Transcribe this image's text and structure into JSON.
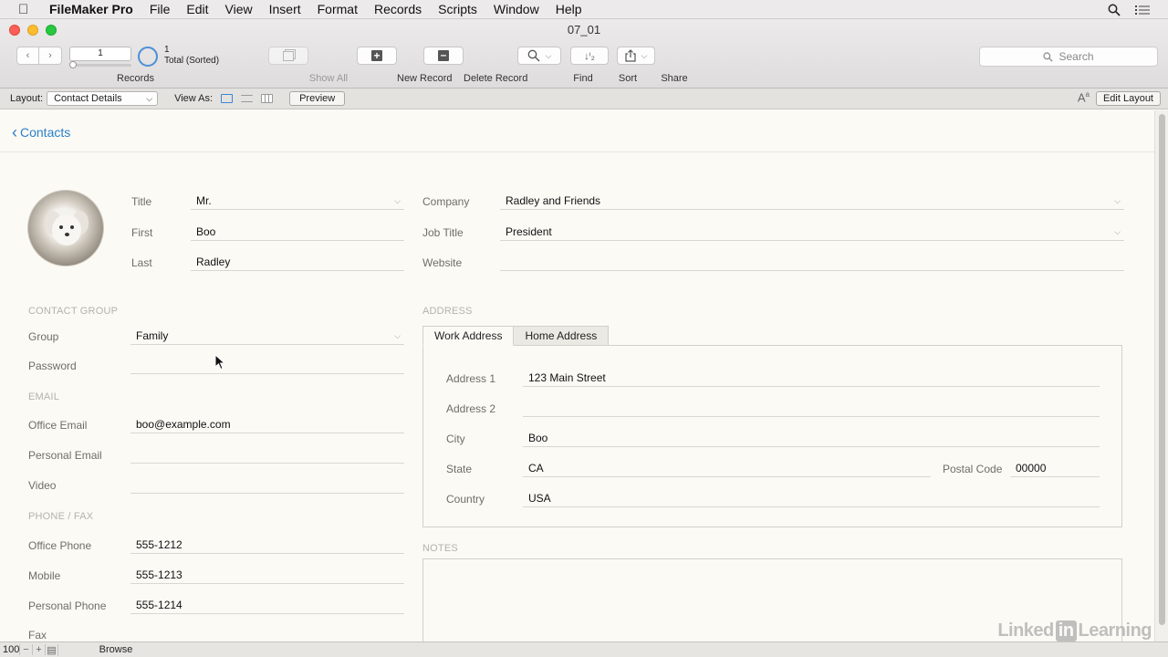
{
  "menubar": {
    "app": "FileMaker Pro",
    "items": [
      "File",
      "Edit",
      "View",
      "Insert",
      "Format",
      "Records",
      "Scripts",
      "Window",
      "Help"
    ]
  },
  "window": {
    "title": "07_01"
  },
  "toolbar": {
    "record_number": "1",
    "record_total": "1",
    "record_status": "Total (Sorted)",
    "records_label": "Records",
    "show_all": "Show All",
    "new_record": "New Record",
    "delete_record": "Delete Record",
    "find": "Find",
    "sort": "Sort",
    "share": "Share",
    "search_placeholder": "Search"
  },
  "layoutbar": {
    "layout_label": "Layout:",
    "layout_value": "Contact Details",
    "view_as_label": "View As:",
    "preview": "Preview",
    "edit_layout": "Edit Layout"
  },
  "content": {
    "back_link": "Contacts",
    "name": {
      "title_label": "Title",
      "title_value": "Mr.",
      "first_label": "First",
      "first_value": "Boo",
      "last_label": "Last",
      "last_value": "Radley"
    },
    "company": {
      "company_label": "Company",
      "company_value": "Radley and Friends",
      "job_label": "Job Title",
      "job_value": "President",
      "website_label": "Website",
      "website_value": ""
    },
    "contact_group": {
      "heading": "CONTACT GROUP",
      "group_label": "Group",
      "group_value": "Family",
      "password_label": "Password",
      "password_value": ""
    },
    "email": {
      "heading": "EMAIL",
      "office_label": "Office Email",
      "office_value": "boo@example.com",
      "personal_label": "Personal Email",
      "personal_value": "",
      "video_label": "Video",
      "video_value": ""
    },
    "phone": {
      "heading": "PHONE / FAX",
      "office_label": "Office Phone",
      "office_value": "555-1212",
      "mobile_label": "Mobile",
      "mobile_value": "555-1213",
      "personal_label": "Personal Phone",
      "personal_value": "555-1214",
      "fax_label": "Fax"
    },
    "address": {
      "heading": "ADDRESS",
      "tabs": [
        "Work Address",
        "Home Address"
      ],
      "address1_label": "Address 1",
      "address1_value": "123 Main Street",
      "address2_label": "Address 2",
      "address2_value": "",
      "city_label": "City",
      "city_value": "Boo",
      "state_label": "State",
      "state_value": "CA",
      "postal_label": "Postal Code",
      "postal_value": "00000",
      "country_label": "Country",
      "country_value": "USA"
    },
    "notes": {
      "heading": "NOTES"
    }
  },
  "statusbar": {
    "zoom": "100",
    "mode": "Browse"
  },
  "watermark": {
    "text1": "Linked",
    "text2": "in",
    "text3": "Learning"
  },
  "colors": {
    "accent": "#2b80c9",
    "close": "#fc5f57",
    "minimize": "#fdbc2e",
    "zoom": "#28c840"
  }
}
